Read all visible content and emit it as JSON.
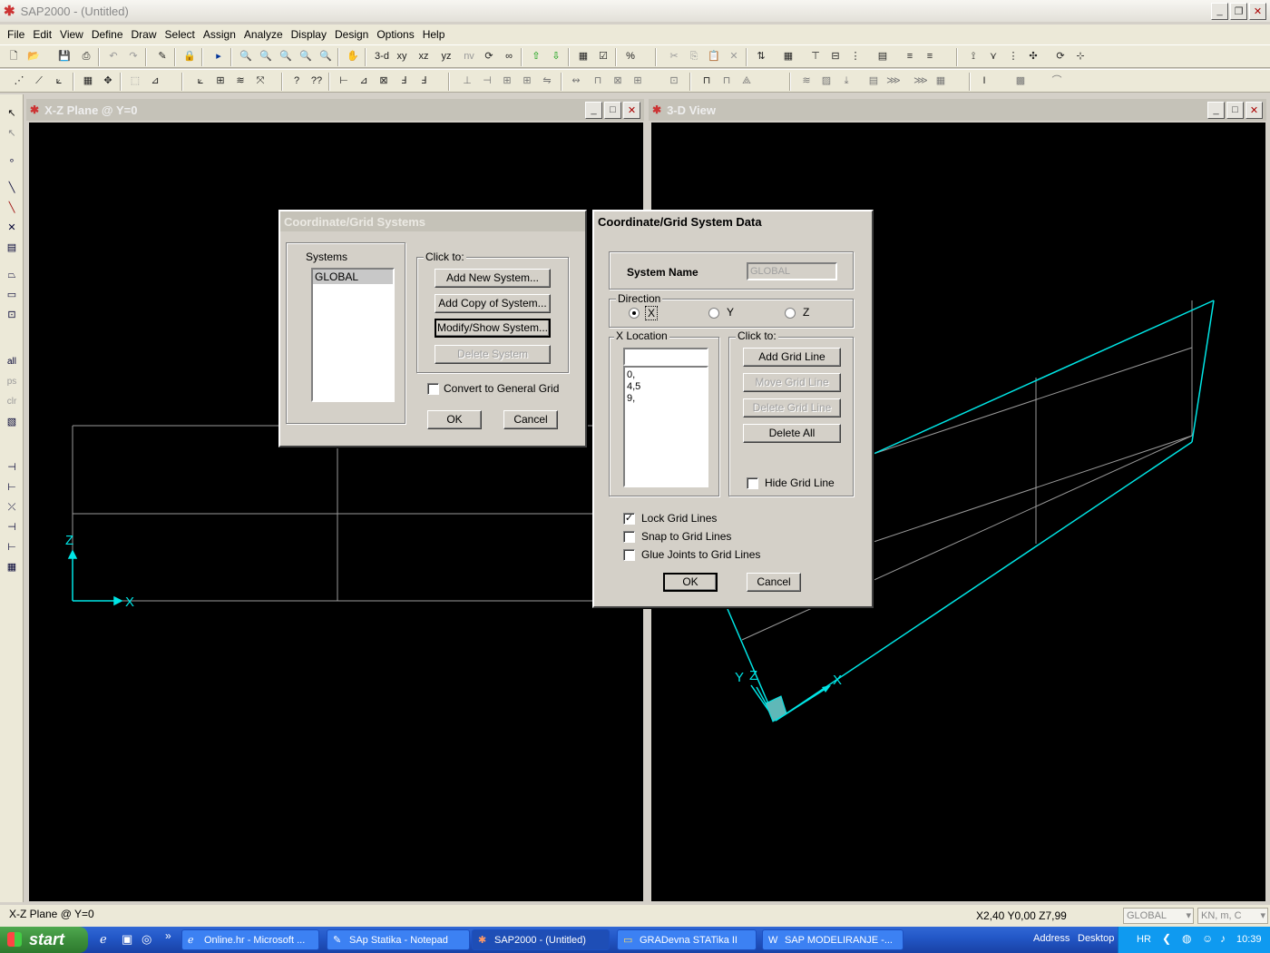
{
  "app": {
    "title": "SAP2000 - (Untitled)",
    "menu": [
      "File",
      "Edit",
      "View",
      "Define",
      "Draw",
      "Select",
      "Assign",
      "Analyze",
      "Display",
      "Design",
      "Options",
      "Help"
    ],
    "toolbar_text": {
      "v3d": "3-d",
      "xy": "xy",
      "xz": "xz",
      "yz": "yz",
      "nv": "nv"
    }
  },
  "left_window": {
    "title": "X-Z Plane @ Y=0",
    "axis_z": "Z",
    "axis_x": "X"
  },
  "right_window": {
    "title": "3-D View",
    "axis_y": "Y",
    "axis_z": "Z",
    "axis_x": "X"
  },
  "dialog_systems": {
    "title": "Coordinate/Grid Systems",
    "systems_label": "Systems",
    "systems": [
      "GLOBAL"
    ],
    "click_to_label": "Click to:",
    "add_new": "Add New System...",
    "add_copy": "Add Copy of System...",
    "modify_show": "Modify/Show System...",
    "delete": "Delete System",
    "convert_label": "Convert to General Grid",
    "convert_checked": false,
    "ok": "OK",
    "cancel": "Cancel"
  },
  "dialog_data": {
    "title": "Coordinate/Grid System Data",
    "system_name_label": "System Name",
    "system_name_value": "GLOBAL",
    "direction_label": "Direction",
    "dir_x": "X",
    "dir_y": "Y",
    "dir_z": "Z",
    "direction_selected": "X",
    "location_label": "X Location",
    "location_input": "",
    "locations": [
      "0,",
      "4,5",
      "9,"
    ],
    "click_to_label": "Click to:",
    "add_grid": "Add Grid Line",
    "move_grid": "Move Grid Line",
    "delete_grid": "Delete Grid Line",
    "delete_all": "Delete All",
    "hide_grid": "Hide Grid Line",
    "lock_grid": "Lock Grid Lines",
    "snap_grid": "Snap to Grid Lines",
    "glue_joints": "Glue Joints to Grid Lines",
    "lock_checked": true,
    "snap_checked": false,
    "glue_checked": false,
    "hide_checked": false,
    "ok": "OK",
    "cancel": "Cancel"
  },
  "status": {
    "left_text": "X-Z Plane @ Y=0",
    "coords": "X2,40  Y0,00  Z7,99",
    "coord_system": "GLOBAL",
    "units": "KN, m, C"
  },
  "taskbar": {
    "start": "start",
    "tasks": [
      "Online.hr - Microsoft ...",
      "SAp Statika - Notepad",
      "SAP2000 - (Untitled)",
      "GRADevna  STATika  II",
      "SAP  MODELIRANJE -..."
    ],
    "address": "Address",
    "desktop": "Desktop",
    "lang": "HR",
    "clock": "10:39"
  },
  "colors": {
    "axis": "#00e5e5",
    "grid": "#9a9a9a",
    "titlebar_inactive": "#c5c2b8",
    "dialog_title_active": "#0a246a"
  }
}
